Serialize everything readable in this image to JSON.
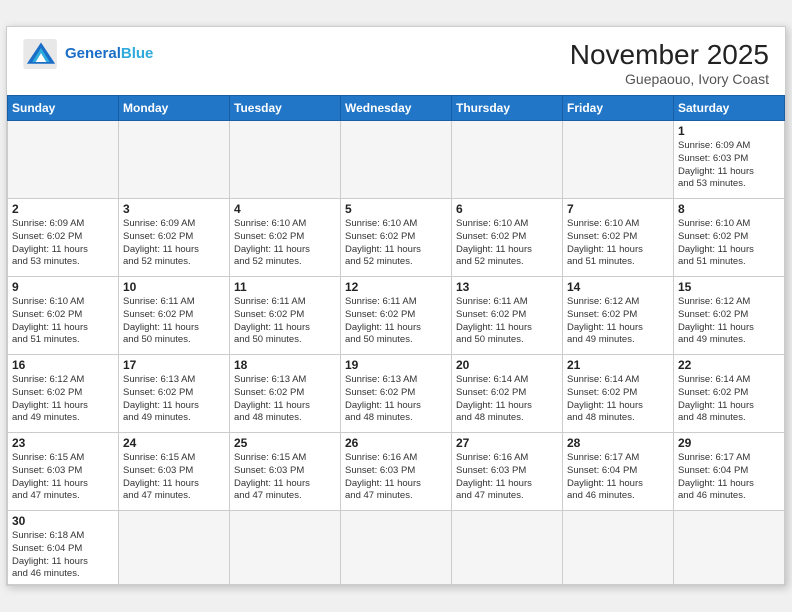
{
  "header": {
    "logo_general": "General",
    "logo_blue": "Blue",
    "month_year": "November 2025",
    "location": "Guepaouo, Ivory Coast"
  },
  "weekdays": [
    "Sunday",
    "Monday",
    "Tuesday",
    "Wednesday",
    "Thursday",
    "Friday",
    "Saturday"
  ],
  "weeks": [
    [
      {
        "day": "",
        "info": ""
      },
      {
        "day": "",
        "info": ""
      },
      {
        "day": "",
        "info": ""
      },
      {
        "day": "",
        "info": ""
      },
      {
        "day": "",
        "info": ""
      },
      {
        "day": "",
        "info": ""
      },
      {
        "day": "1",
        "info": "Sunrise: 6:09 AM\nSunset: 6:03 PM\nDaylight: 11 hours\nand 53 minutes."
      }
    ],
    [
      {
        "day": "2",
        "info": "Sunrise: 6:09 AM\nSunset: 6:02 PM\nDaylight: 11 hours\nand 53 minutes."
      },
      {
        "day": "3",
        "info": "Sunrise: 6:09 AM\nSunset: 6:02 PM\nDaylight: 11 hours\nand 52 minutes."
      },
      {
        "day": "4",
        "info": "Sunrise: 6:10 AM\nSunset: 6:02 PM\nDaylight: 11 hours\nand 52 minutes."
      },
      {
        "day": "5",
        "info": "Sunrise: 6:10 AM\nSunset: 6:02 PM\nDaylight: 11 hours\nand 52 minutes."
      },
      {
        "day": "6",
        "info": "Sunrise: 6:10 AM\nSunset: 6:02 PM\nDaylight: 11 hours\nand 52 minutes."
      },
      {
        "day": "7",
        "info": "Sunrise: 6:10 AM\nSunset: 6:02 PM\nDaylight: 11 hours\nand 51 minutes."
      },
      {
        "day": "8",
        "info": "Sunrise: 6:10 AM\nSunset: 6:02 PM\nDaylight: 11 hours\nand 51 minutes."
      }
    ],
    [
      {
        "day": "9",
        "info": "Sunrise: 6:10 AM\nSunset: 6:02 PM\nDaylight: 11 hours\nand 51 minutes."
      },
      {
        "day": "10",
        "info": "Sunrise: 6:11 AM\nSunset: 6:02 PM\nDaylight: 11 hours\nand 50 minutes."
      },
      {
        "day": "11",
        "info": "Sunrise: 6:11 AM\nSunset: 6:02 PM\nDaylight: 11 hours\nand 50 minutes."
      },
      {
        "day": "12",
        "info": "Sunrise: 6:11 AM\nSunset: 6:02 PM\nDaylight: 11 hours\nand 50 minutes."
      },
      {
        "day": "13",
        "info": "Sunrise: 6:11 AM\nSunset: 6:02 PM\nDaylight: 11 hours\nand 50 minutes."
      },
      {
        "day": "14",
        "info": "Sunrise: 6:12 AM\nSunset: 6:02 PM\nDaylight: 11 hours\nand 49 minutes."
      },
      {
        "day": "15",
        "info": "Sunrise: 6:12 AM\nSunset: 6:02 PM\nDaylight: 11 hours\nand 49 minutes."
      }
    ],
    [
      {
        "day": "16",
        "info": "Sunrise: 6:12 AM\nSunset: 6:02 PM\nDaylight: 11 hours\nand 49 minutes."
      },
      {
        "day": "17",
        "info": "Sunrise: 6:13 AM\nSunset: 6:02 PM\nDaylight: 11 hours\nand 49 minutes."
      },
      {
        "day": "18",
        "info": "Sunrise: 6:13 AM\nSunset: 6:02 PM\nDaylight: 11 hours\nand 48 minutes."
      },
      {
        "day": "19",
        "info": "Sunrise: 6:13 AM\nSunset: 6:02 PM\nDaylight: 11 hours\nand 48 minutes."
      },
      {
        "day": "20",
        "info": "Sunrise: 6:14 AM\nSunset: 6:02 PM\nDaylight: 11 hours\nand 48 minutes."
      },
      {
        "day": "21",
        "info": "Sunrise: 6:14 AM\nSunset: 6:02 PM\nDaylight: 11 hours\nand 48 minutes."
      },
      {
        "day": "22",
        "info": "Sunrise: 6:14 AM\nSunset: 6:02 PM\nDaylight: 11 hours\nand 48 minutes."
      }
    ],
    [
      {
        "day": "23",
        "info": "Sunrise: 6:15 AM\nSunset: 6:03 PM\nDaylight: 11 hours\nand 47 minutes."
      },
      {
        "day": "24",
        "info": "Sunrise: 6:15 AM\nSunset: 6:03 PM\nDaylight: 11 hours\nand 47 minutes."
      },
      {
        "day": "25",
        "info": "Sunrise: 6:15 AM\nSunset: 6:03 PM\nDaylight: 11 hours\nand 47 minutes."
      },
      {
        "day": "26",
        "info": "Sunrise: 6:16 AM\nSunset: 6:03 PM\nDaylight: 11 hours\nand 47 minutes."
      },
      {
        "day": "27",
        "info": "Sunrise: 6:16 AM\nSunset: 6:03 PM\nDaylight: 11 hours\nand 47 minutes."
      },
      {
        "day": "28",
        "info": "Sunrise: 6:17 AM\nSunset: 6:04 PM\nDaylight: 11 hours\nand 46 minutes."
      },
      {
        "day": "29",
        "info": "Sunrise: 6:17 AM\nSunset: 6:04 PM\nDaylight: 11 hours\nand 46 minutes."
      }
    ],
    [
      {
        "day": "30",
        "info": "Sunrise: 6:18 AM\nSunset: 6:04 PM\nDaylight: 11 hours\nand 46 minutes."
      },
      {
        "day": "",
        "info": ""
      },
      {
        "day": "",
        "info": ""
      },
      {
        "day": "",
        "info": ""
      },
      {
        "day": "",
        "info": ""
      },
      {
        "day": "",
        "info": ""
      },
      {
        "day": "",
        "info": ""
      }
    ]
  ]
}
